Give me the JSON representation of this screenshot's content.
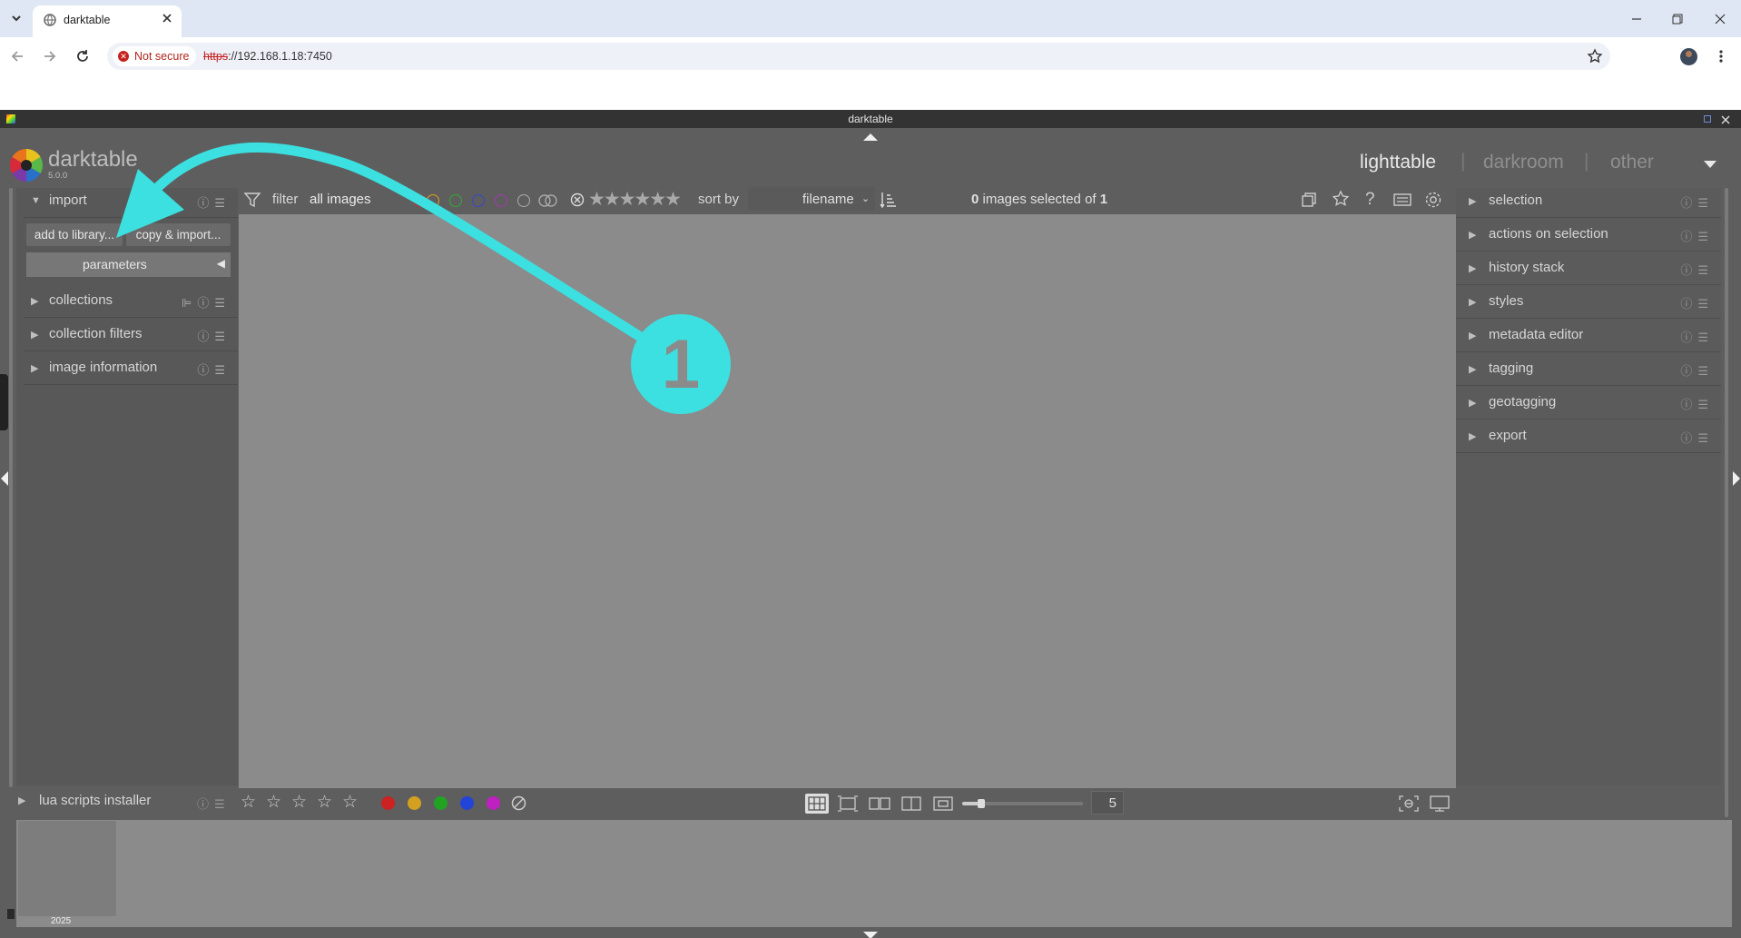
{
  "browser": {
    "tab_title": "darktable",
    "security_label": "Not secure",
    "url_scheme": "https",
    "url_rest": "://192.168.1.18:7450",
    "icons": [
      "tab-list-icon",
      "favicon-icon",
      "close-tab-icon",
      "minimize-icon",
      "maximize-icon",
      "close-window-icon",
      "back-icon",
      "forward-icon",
      "reload-icon",
      "bookmark-star-icon",
      "profile-avatar",
      "browser-menu-icon"
    ]
  },
  "dt": {
    "window_title": "darktable",
    "logo_name": "darktable",
    "version": "5.0.0",
    "views": {
      "lighttable": "lighttable",
      "sep1": "|",
      "darkroom": "darkroom",
      "sep2": "|",
      "other": "other"
    },
    "left_modules": {
      "import": "import",
      "add_to_library": "add to library...",
      "copy_import": "copy & import...",
      "parameters": "parameters",
      "collections": "collections",
      "collection_filters": "collection filters",
      "image_information": "image information",
      "lua_scripts_installer": "lua scripts installer"
    },
    "top_toolbar": {
      "filter_label": "filter",
      "filter_value": "all images",
      "sort_by_label": "sort by",
      "sort_value": "filename",
      "selection_count": "0",
      "selection_text": " images selected of ",
      "selection_total": "1"
    },
    "right_modules": {
      "selection": "selection",
      "actions_on_selection": "actions on selection",
      "history_stack": "history stack",
      "styles": "styles",
      "metadata_editor": "metadata editor",
      "tagging": "tagging",
      "geotagging": "geotagging",
      "export": "export"
    },
    "bottom_toolbar": {
      "thumbs_per_row": "5",
      "color_labels": [
        "#cc2222",
        "#d4a020",
        "#22a322",
        "#2244d8",
        "#c020c0"
      ]
    },
    "filmstrip": {
      "year_label": "2025"
    },
    "annotation": {
      "step_number": "1",
      "accent_color": "#3ce0e0"
    }
  }
}
